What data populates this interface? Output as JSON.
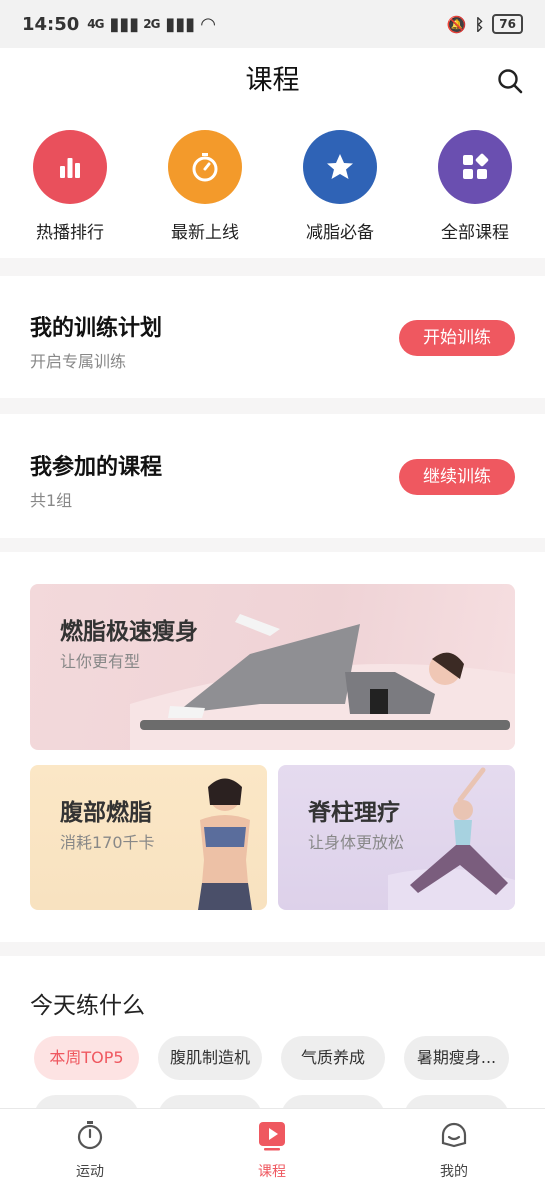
{
  "status_bar": {
    "time": "14:50",
    "sig1": "4G",
    "sig2": "2G",
    "battery": "76"
  },
  "header": {
    "title": "课程"
  },
  "quick_links": [
    {
      "label": "热播排行",
      "icon": "bar-chart-icon",
      "color": "#e9505c"
    },
    {
      "label": "最新上线",
      "icon": "stopwatch-icon",
      "color": "#f39a2b"
    },
    {
      "label": "减脂必备",
      "icon": "star-icon",
      "color": "#2f63b6"
    },
    {
      "label": "全部课程",
      "icon": "grid-icon",
      "color": "#6a4fb0"
    }
  ],
  "plan_card": {
    "title": "我的训练计划",
    "subtitle": "开启专属训练",
    "button": "开始训练"
  },
  "joined_card": {
    "title": "我参加的课程",
    "subtitle": "共1组",
    "button": "继续训练"
  },
  "banners": {
    "main": {
      "title": "燃脂极速瘦身",
      "subtitle": "让你更有型"
    },
    "left": {
      "title": "腹部燃脂",
      "subtitle": "消耗170千卡"
    },
    "right": {
      "title": "脊柱理疗",
      "subtitle": "让身体更放松"
    }
  },
  "today": {
    "title": "今天练什么",
    "chips": [
      "本周TOP5",
      "腹肌制造机",
      "气质养成",
      "暑期瘦身..."
    ]
  },
  "tabbar": {
    "items": [
      "运动",
      "课程",
      "我的"
    ],
    "active": "课程",
    "accent": "#ef5860"
  }
}
